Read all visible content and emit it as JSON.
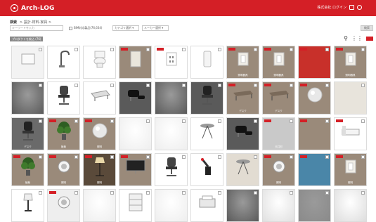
{
  "app": {
    "logo_text": "Arch-LOG"
  },
  "header": {
    "user_label": "株式会社 ログイン"
  },
  "search": {
    "heading": "検索",
    "breadcrumb": "> 設計-材料-家具 >",
    "placeholder": "キーワードを入力",
    "checkbox_label": "BIM対応製品(76,634)",
    "dropdown1": "カテゴリ選択 ▾",
    "dropdown2": "メーカー選択 ▾",
    "button_label": "検索"
  },
  "toolbar": {
    "category_chip": "プロダクトを絞込 (76)"
  },
  "tiles": [
    {
      "bg": "#f3f3f3",
      "kind": "box",
      "label": "",
      "dark": true,
      "badge": false
    },
    {
      "bg": "#ffffff",
      "kind": "faucet",
      "label": "",
      "dark": true,
      "badge": false
    },
    {
      "bg": "#ffffff",
      "kind": "toilet",
      "label": "",
      "dark": true,
      "badge": false
    },
    {
      "bg": "#9a8a7a",
      "kind": "panel",
      "label": "",
      "dark": false,
      "badge": true
    },
    {
      "bg": "#ffffff",
      "kind": "outlet",
      "label": "",
      "dark": true,
      "badge": true
    },
    {
      "bg": "#ffffff",
      "kind": "fixture",
      "label": "",
      "dark": true,
      "badge": false
    },
    {
      "bg": "#9a8a7a",
      "kind": "switch",
      "label": "照明器具",
      "dark": false,
      "badge": true
    },
    {
      "bg": "#9a8a7a",
      "kind": "switch",
      "label": "照明器具",
      "dark": false,
      "badge": true
    },
    {
      "bg": "#c8302a",
      "kind": "flat",
      "label": "",
      "dark": false,
      "badge": true
    },
    {
      "bg": "#9a8a7a",
      "kind": "switch",
      "label": "照明器具",
      "dark": false,
      "badge": true
    },
    {
      "bg": "#5a5a5a",
      "kind": "gradient",
      "label": "",
      "dark": false,
      "badge": false
    },
    {
      "bg": "#ffffff",
      "kind": "chair",
      "label": "",
      "dark": true,
      "badge": false
    },
    {
      "bg": "#ffffff",
      "kind": "table",
      "label": "",
      "dark": true,
      "badge": false
    },
    {
      "bg": "#5a5a5a",
      "kind": "lounge",
      "label": "",
      "dark": false,
      "badge": false
    },
    {
      "bg": "#5a5a5a",
      "kind": "gradient",
      "label": "",
      "dark": false,
      "badge": false
    },
    {
      "bg": "#5a5a5a",
      "kind": "chair",
      "label": "",
      "dark": false,
      "badge": false
    },
    {
      "bg": "#9a8a7a",
      "kind": "desk",
      "label": "デスク",
      "dark": false,
      "badge": true
    },
    {
      "bg": "#9a8a7a",
      "kind": "desk",
      "label": "デスク",
      "dark": false,
      "badge": true
    },
    {
      "bg": "#9a8a7a",
      "kind": "sphere",
      "label": "",
      "dark": false,
      "badge": true
    },
    {
      "bg": "#e8e4dc",
      "kind": "flat",
      "label": "",
      "dark": true,
      "badge": false
    },
    {
      "bg": "#6a6a6a",
      "kind": "chair",
      "label": "デスク",
      "dark": false,
      "badge": false
    },
    {
      "bg": "#9a8a7a",
      "kind": "plant",
      "label": "植栽",
      "dark": false,
      "badge": true
    },
    {
      "bg": "#9a8a7a",
      "kind": "sphere",
      "label": "照明",
      "dark": false,
      "badge": true
    },
    {
      "bg": "#eeeeee",
      "kind": "gradient",
      "label": "",
      "dark": true,
      "badge": false
    },
    {
      "bg": "#eeeeee",
      "kind": "gradient",
      "label": "",
      "dark": true,
      "badge": false
    },
    {
      "bg": "#ffffff",
      "kind": "stool",
      "label": "",
      "dark": true,
      "badge": false
    },
    {
      "bg": "#5a5a5a",
      "kind": "lounge",
      "label": "",
      "dark": false,
      "badge": false
    },
    {
      "bg": "#c9c9c9",
      "kind": "flat",
      "label": "天井材",
      "dark": false,
      "badge": true
    },
    {
      "bg": "#9a8a7a",
      "kind": "flat",
      "label": "",
      "dark": false,
      "badge": true
    },
    {
      "bg": "#ffffff",
      "kind": "bed",
      "label": "",
      "dark": true,
      "badge": true
    },
    {
      "bg": "#9a8a7a",
      "kind": "plant",
      "label": "植栽",
      "dark": false,
      "badge": true
    },
    {
      "bg": "#9a8a7a",
      "kind": "downlight",
      "label": "照明",
      "dark": false,
      "badge": true
    },
    {
      "bg": "#5a4a3a",
      "kind": "floorlamp",
      "label": "照明",
      "dark": false,
      "badge": true
    },
    {
      "bg": "#9a8a7a",
      "kind": "tv",
      "label": "",
      "dark": false,
      "badge": true
    },
    {
      "bg": "#ffffff",
      "kind": "chair",
      "label": "",
      "dark": true,
      "badge": false
    },
    {
      "bg": "#ffffff",
      "kind": "robot",
      "label": "",
      "dark": true,
      "badge": false
    },
    {
      "bg": "#e2dcd2",
      "kind": "stool",
      "label": "",
      "dark": true,
      "badge": false
    },
    {
      "bg": "#9a8a7a",
      "kind": "downlight",
      "label": "照明",
      "dark": false,
      "badge": true
    },
    {
      "bg": "#4a86a8",
      "kind": "flat",
      "label": "",
      "dark": false,
      "badge": true
    },
    {
      "bg": "#9a8a7a",
      "kind": "switch",
      "label": "照明",
      "dark": false,
      "badge": true
    },
    {
      "bg": "#ffffff",
      "kind": "lamp",
      "label": "",
      "dark": true,
      "badge": false
    },
    {
      "bg": "#eeeeee",
      "kind": "downlight",
      "label": "",
      "dark": true,
      "badge": true
    },
    {
      "bg": "#eeeeee",
      "kind": "gradient",
      "label": "",
      "dark": true,
      "badge": false
    },
    {
      "bg": "#ffffff",
      "kind": "cabinet",
      "label": "",
      "dark": true,
      "badge": false
    },
    {
      "bg": "#eeeeee",
      "kind": "gradient",
      "label": "",
      "dark": true,
      "badge": false
    },
    {
      "bg": "#ffffff",
      "kind": "printer",
      "label": "",
      "dark": true,
      "badge": false
    },
    {
      "bg": "#5a5a5a",
      "kind": "gradient",
      "label": "",
      "dark": false,
      "badge": false
    },
    {
      "bg": "#e0e0e0",
      "kind": "gradient",
      "label": "",
      "dark": true,
      "badge": false
    },
    {
      "bg": "#8a8a8a",
      "kind": "gradient",
      "label": "",
      "dark": false,
      "badge": false
    },
    {
      "bg": "#dddddd",
      "kind": "gradient",
      "label": "",
      "dark": true,
      "badge": false
    }
  ]
}
